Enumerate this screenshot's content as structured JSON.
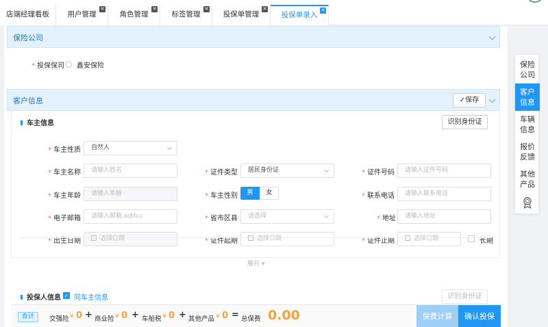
{
  "tabs": [
    {
      "label": "店端经理看板",
      "closable": false
    },
    {
      "label": "用户管理",
      "closable": true
    },
    {
      "label": "角色管理",
      "closable": true
    },
    {
      "label": "标签管理",
      "closable": true
    },
    {
      "label": "投保单管理",
      "closable": true
    },
    {
      "label": "投保单录入",
      "closable": true,
      "active": true
    }
  ],
  "insurer_section": {
    "title": "保险公司",
    "field_label": "投保保司",
    "option": "鑫安保险"
  },
  "customer_section": {
    "title": "客户信息",
    "save_label": "✓保存"
  },
  "owner": {
    "title": "车主信息",
    "id_button": "识别身份证",
    "nature_label": "车主性质",
    "nature_value": "自然人",
    "name_label": "车主名称",
    "name_placeholder": "请输入姓名",
    "idtype_label": "证件类型",
    "idtype_value": "居民身份证",
    "idno_label": "证件号码",
    "idno_placeholder": "请输入证件号码",
    "age_label": "车主年龄",
    "age_placeholder": "请输入年龄",
    "gender_label": "车主性别",
    "gender_male": "男",
    "gender_female": "女",
    "phone_label": "联系电话",
    "phone_placeholder": "请输入联系电话",
    "email_label": "电子邮箱",
    "email_placeholder": "请输入邮箱,a@b.c",
    "region_label": "省市区县",
    "region_placeholder": "请选择",
    "address_label": "地址",
    "address_placeholder": "请输入地址",
    "birth_label": "出生日期",
    "birth_placeholder": "选择日期",
    "start_label": "证件起期",
    "start_placeholder": "选择日期",
    "end_label": "证件止期",
    "end_placeholder": "选择日期",
    "longterm_label": "长期",
    "expand_label": "展开 ▾"
  },
  "applicant": {
    "title": "投保人信息",
    "same_label": "同车主信息",
    "id_button": "识别身份证"
  },
  "bottom_bar": {
    "total_tag": "合计",
    "currency": "¥",
    "items": [
      {
        "label": "交强险",
        "value": "0"
      },
      {
        "label": "商业险",
        "value": "0"
      },
      {
        "label": "车船税",
        "value": "0"
      },
      {
        "label": "其他产品",
        "value": "0"
      }
    ],
    "plus": "+",
    "equals": "=",
    "total_label": "总保费",
    "total_value": "0.00",
    "calc_button": "保费计算",
    "confirm_button": "确认投保"
  },
  "anchor_nav": [
    {
      "label": "保险公司",
      "active": false
    },
    {
      "label": "客户信息",
      "active": true
    },
    {
      "label": "车辆信息",
      "active": false
    },
    {
      "label": "报价反馈",
      "active": false
    },
    {
      "label": "其他产品",
      "active": false
    }
  ],
  "colors": {
    "primary": "#2196f3",
    "section_bg": "#e3f2fd",
    "amount": "#f0a33e",
    "required": "#f56c6c"
  }
}
